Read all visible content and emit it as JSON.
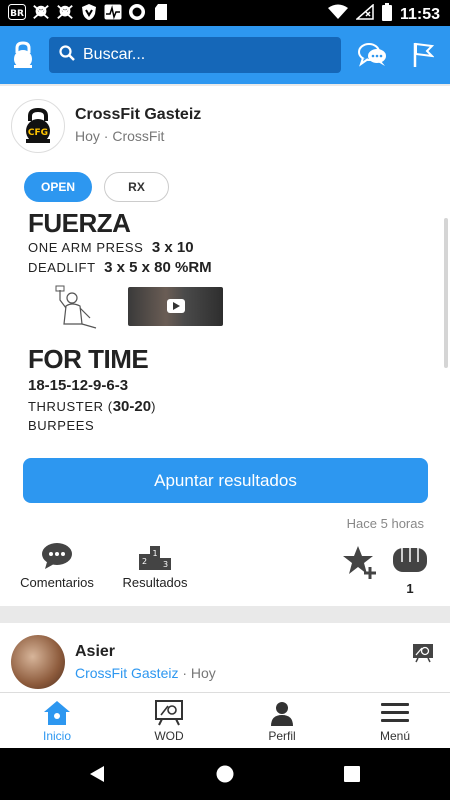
{
  "status_bar": {
    "time": "11:53",
    "icons": [
      "br-icon",
      "skull-icon",
      "skull-icon",
      "shield-icon",
      "activity-icon",
      "record-icon",
      "sd-card-icon",
      "wifi-icon",
      "no-signal-icon",
      "battery-icon"
    ]
  },
  "app_bar": {
    "search_placeholder": "Buscar...",
    "colors": {
      "bar": "#2d97f0",
      "search_bg": "#1567b8"
    }
  },
  "post": {
    "box_name": "CrossFit Gasteiz",
    "subtitle": "Hoy · CrossFit",
    "avatar_text": "CFG",
    "tabs": [
      {
        "label": "OPEN",
        "active": true
      },
      {
        "label": "RX",
        "active": false
      }
    ],
    "sections": [
      {
        "title": "FUERZA",
        "lines": [
          {
            "name": "ONE ARM PRESS",
            "value": "3 x 10"
          },
          {
            "name": "DEADLIFT",
            "value": "3 x 5 x 80 %RM"
          }
        ]
      },
      {
        "title": "FOR TIME",
        "lines": [
          {
            "name": "",
            "value": "18-15-12-9-6-3"
          },
          {
            "name": "THRUSTER (",
            "value": "30-20",
            "suffix": ")"
          },
          {
            "name": "BURPEES",
            "value": ""
          }
        ]
      }
    ],
    "log_button": "Apuntar resultados",
    "time_ago": "Hace 5 horas",
    "actions": [
      {
        "label": "Comentarios",
        "icon": "comment-icon"
      },
      {
        "label": "Resultados",
        "icon": "podium-icon"
      }
    ],
    "reactions": {
      "favorite_icon": "star-plus-icon",
      "fist_icon": "fist-icon",
      "fist_count": "1"
    }
  },
  "next_post": {
    "name": "Asier",
    "box_link": "CrossFit Gasteiz",
    "time": "· Hoy"
  },
  "bottom_nav": [
    {
      "label": "Inicio",
      "icon": "home-icon",
      "active": true
    },
    {
      "label": "WOD",
      "icon": "wod-icon",
      "active": false
    },
    {
      "label": "Perfil",
      "icon": "person-icon",
      "active": false
    },
    {
      "label": "Menú",
      "icon": "menu-icon",
      "active": false
    }
  ]
}
